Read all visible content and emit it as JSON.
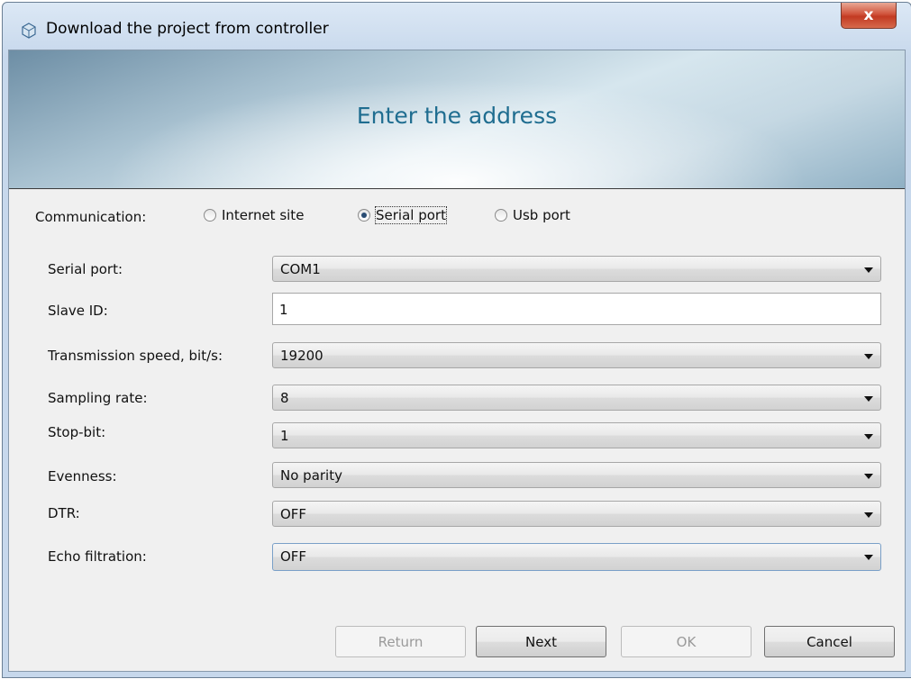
{
  "window": {
    "title": "Download the project from controller",
    "close_symbol": "x"
  },
  "banner": {
    "title": "Enter the address"
  },
  "communication": {
    "label": "Communication:",
    "options": [
      {
        "label": "Internet site",
        "checked": false
      },
      {
        "label": "Serial port",
        "checked": true
      },
      {
        "label": "Usb port",
        "checked": false
      }
    ]
  },
  "fields": {
    "serial_port": {
      "label": "Serial port:",
      "value": "COM1"
    },
    "slave_id": {
      "label": "Slave ID:",
      "value": "1"
    },
    "transmission_speed": {
      "label": "Transmission speed, bit/s:",
      "value": "19200"
    },
    "sampling_rate": {
      "label": "Sampling rate:",
      "value": "8"
    },
    "stop_bit": {
      "label": "Stop-bit:",
      "value": "1"
    },
    "evenness": {
      "label": "Evenness:",
      "value": "No parity"
    },
    "dtr": {
      "label": "DTR:",
      "value": "OFF"
    },
    "echo_filtration": {
      "label": "Echo filtration:",
      "value": "OFF"
    }
  },
  "buttons": {
    "return": {
      "label": "Return",
      "enabled": false
    },
    "next": {
      "label": "Next",
      "enabled": true
    },
    "ok": {
      "label": "OK",
      "enabled": false
    },
    "cancel": {
      "label": "Cancel",
      "enabled": true
    }
  },
  "icons": {
    "app": "app-cube-icon",
    "close": "close-icon",
    "dropdown": "chevron-down-icon"
  },
  "colors": {
    "banner_title": "#1f6d90",
    "close_button": "#c9452c"
  }
}
